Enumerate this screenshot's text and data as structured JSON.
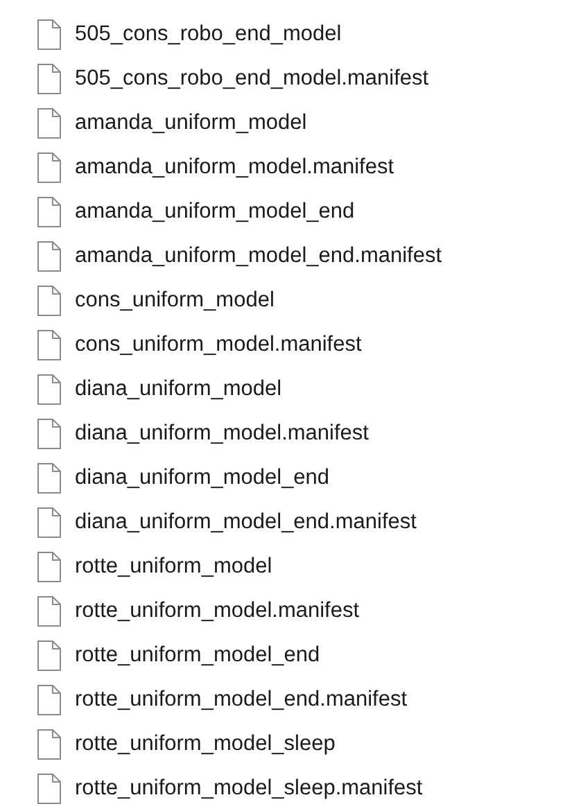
{
  "files": [
    {
      "name": "505_cons_robo_end_model"
    },
    {
      "name": "505_cons_robo_end_model.manifest"
    },
    {
      "name": "amanda_uniform_model"
    },
    {
      "name": "amanda_uniform_model.manifest"
    },
    {
      "name": "amanda_uniform_model_end"
    },
    {
      "name": "amanda_uniform_model_end.manifest"
    },
    {
      "name": "cons_uniform_model"
    },
    {
      "name": "cons_uniform_model.manifest"
    },
    {
      "name": "diana_uniform_model"
    },
    {
      "name": "diana_uniform_model.manifest"
    },
    {
      "name": "diana_uniform_model_end"
    },
    {
      "name": "diana_uniform_model_end.manifest"
    },
    {
      "name": "rotte_uniform_model"
    },
    {
      "name": "rotte_uniform_model.manifest"
    },
    {
      "name": "rotte_uniform_model_end"
    },
    {
      "name": "rotte_uniform_model_end.manifest"
    },
    {
      "name": "rotte_uniform_model_sleep"
    },
    {
      "name": "rotte_uniform_model_sleep.manifest"
    }
  ]
}
